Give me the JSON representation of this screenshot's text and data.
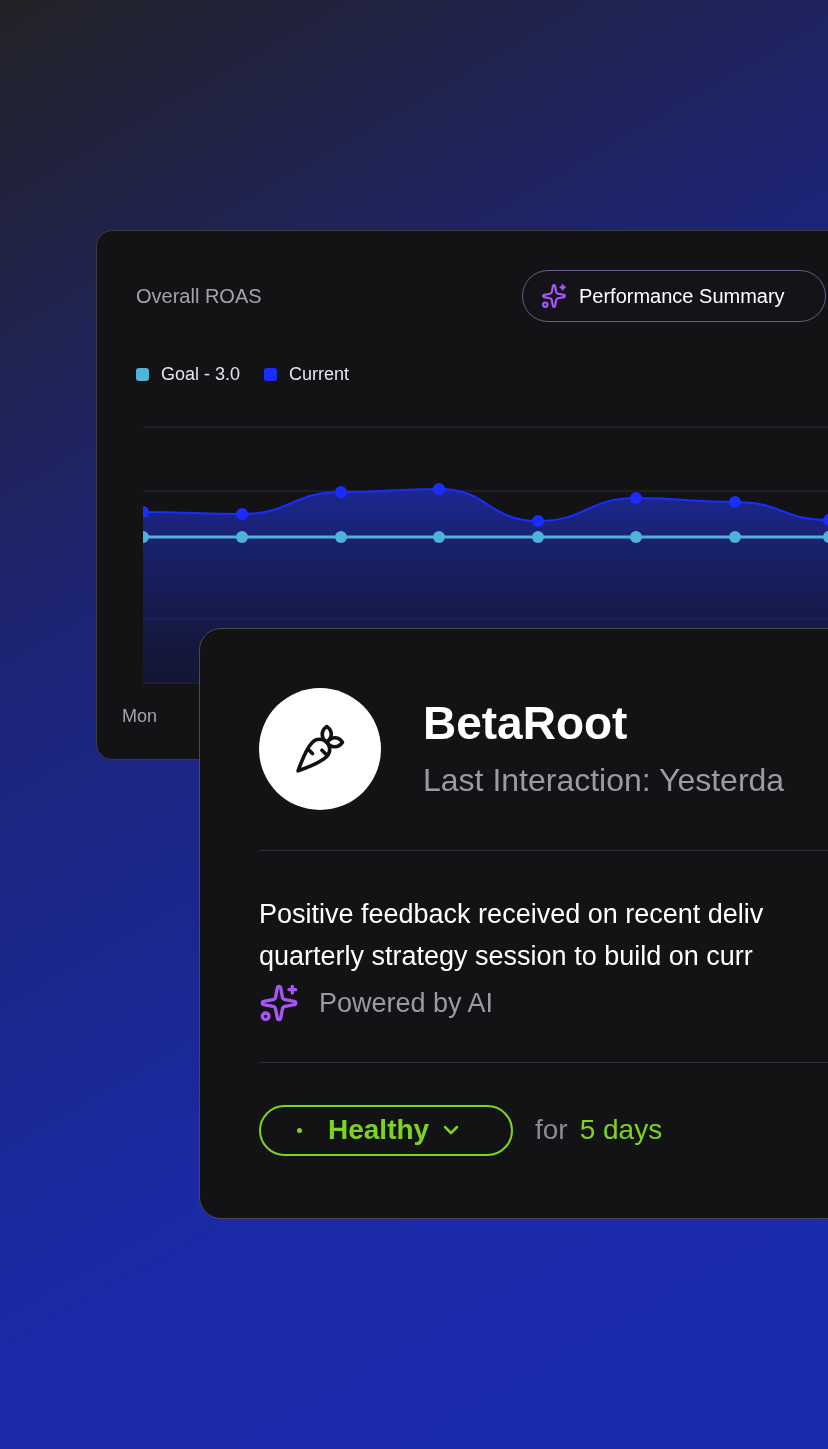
{
  "chart_card": {
    "title": "Overall ROAS",
    "summary_button": {
      "label": "Performance Summary"
    },
    "legend": [
      {
        "label": "Goal - 3.0",
        "color": "#4fb3d9"
      },
      {
        "label": "Current",
        "color": "#1a2cff"
      }
    ],
    "x_labels": [
      "Mon"
    ]
  },
  "account_card": {
    "name": "BetaRoot",
    "last_interaction": "Last Interaction: Yesterda",
    "summary_lines": [
      "Positive feedback received on recent deliv",
      "quarterly strategy session to build on curr"
    ],
    "ai_note": "Powered by AI",
    "status": {
      "label": "Healthy"
    },
    "duration_prefix": "for",
    "duration": "5 days"
  }
}
